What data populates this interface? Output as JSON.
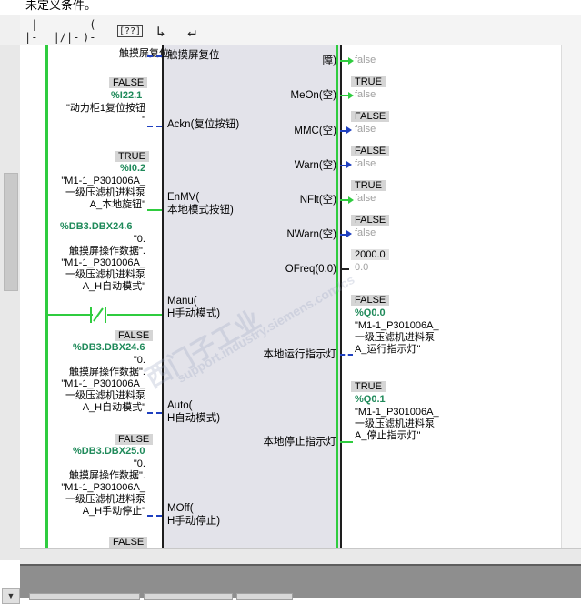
{
  "title_strip": {
    "text": "未定义条件。"
  },
  "toolbar": {
    "buttons": [
      {
        "icon": "no-contact-icon",
        "glyph": "-| |-"
      },
      {
        "icon": "nc-contact-icon",
        "glyph": "-|/|-"
      },
      {
        "icon": "coil-icon",
        "glyph": "-( )-"
      },
      {
        "icon": "empty-box-icon",
        "glyph": "[??]"
      },
      {
        "icon": "open-branch-icon",
        "glyph": "↳"
      },
      {
        "icon": "close-branch-icon",
        "glyph": "↵"
      }
    ]
  },
  "block": {
    "inputs": {
      "top_pin": "触摸屏复位",
      "ackn": "Ackn(复位按钮)",
      "enmv": [
        "EnMV(",
        "本地模式按钮)"
      ],
      "manu": [
        "Manu(",
        "H手动模式)"
      ],
      "auto": [
        "Auto(",
        "H自动模式)"
      ],
      "moff": [
        "MOff(",
        "H手动停止)"
      ]
    },
    "outputs": {
      "top_pin": [
        "障)"
      ],
      "meon": "MeOn(空)",
      "mmc": "MMC(空)",
      "warn": "Warn(空)",
      "nflt": "NFlt(空)",
      "nwarn": "NWarn(空)",
      "ofreq": "OFreq(0.0)",
      "run_lamp": "本地运行指示灯",
      "stop_lamp": "本地停止指示灯"
    }
  },
  "left_operands": {
    "top_symbol": "触摸屏复位",
    "op1": {
      "value": "FALSE",
      "address": "%I22.1",
      "symbol": [
        "\"动力柜1复位按钮",
        "\""
      ]
    },
    "op2": {
      "value": "TRUE",
      "address": "%I0.2",
      "symbol": [
        "\"M1-1_P301006A_",
        "一级压滤机进料泵",
        "A_本地旋钮\""
      ]
    },
    "op3": {
      "address": "%DB3.DBX24.6",
      "symbol": [
        "\"0.",
        "触摸屏操作数据\".",
        "\"M1-1_P301006A_",
        "一级压滤机进料泵",
        "A_H自动模式\""
      ]
    },
    "op4": {
      "value": "FALSE",
      "address": "%DB3.DBX24.6",
      "symbol": [
        "\"0.",
        "触摸屏操作数据\".",
        "\"M1-1_P301006A_",
        "一级压滤机进料泵",
        "A_H自动模式\""
      ]
    },
    "op5": {
      "value": "FALSE",
      "address": "%DB3.DBX25.0",
      "symbol": [
        "\"0.",
        "触摸屏操作数据\".",
        "\"M1-1_P301006A_",
        "一级压滤机进料泵",
        "A_H手动停止\""
      ]
    },
    "op6": {
      "value": "FALSE"
    }
  },
  "right_operands": {
    "top": {
      "live": "false"
    },
    "meon": {
      "value": "TRUE",
      "live": "false"
    },
    "mmc": {
      "value": "FALSE",
      "live": "false"
    },
    "warn": {
      "value": "FALSE",
      "live": "false"
    },
    "nflt": {
      "value": "TRUE",
      "live": "false"
    },
    "nwarn": {
      "value": "FALSE",
      "live": "false"
    },
    "ofreq": {
      "value": "2000.0",
      "live": "0.0"
    },
    "q0": {
      "value": "FALSE",
      "address": "%Q0.0",
      "symbol": [
        "\"M1-1_P301006A_",
        "一级压滤机进料泵",
        "A_运行指示灯\""
      ]
    },
    "q1": {
      "value": "TRUE",
      "address": "%Q0.1",
      "symbol": [
        "\"M1-1_P301006A_",
        "一级压滤机进料泵",
        "A_停止指示灯\""
      ]
    }
  },
  "watermark": {
    "line1": "西门子工业",
    "line2": "support.industry.siemens.com/cs"
  },
  "colors": {
    "rail_green": "#2fcc3f",
    "wire_blue": "#1f40c0",
    "address_green": "#1f8a5a",
    "block_fill": "#e3e3ea"
  }
}
